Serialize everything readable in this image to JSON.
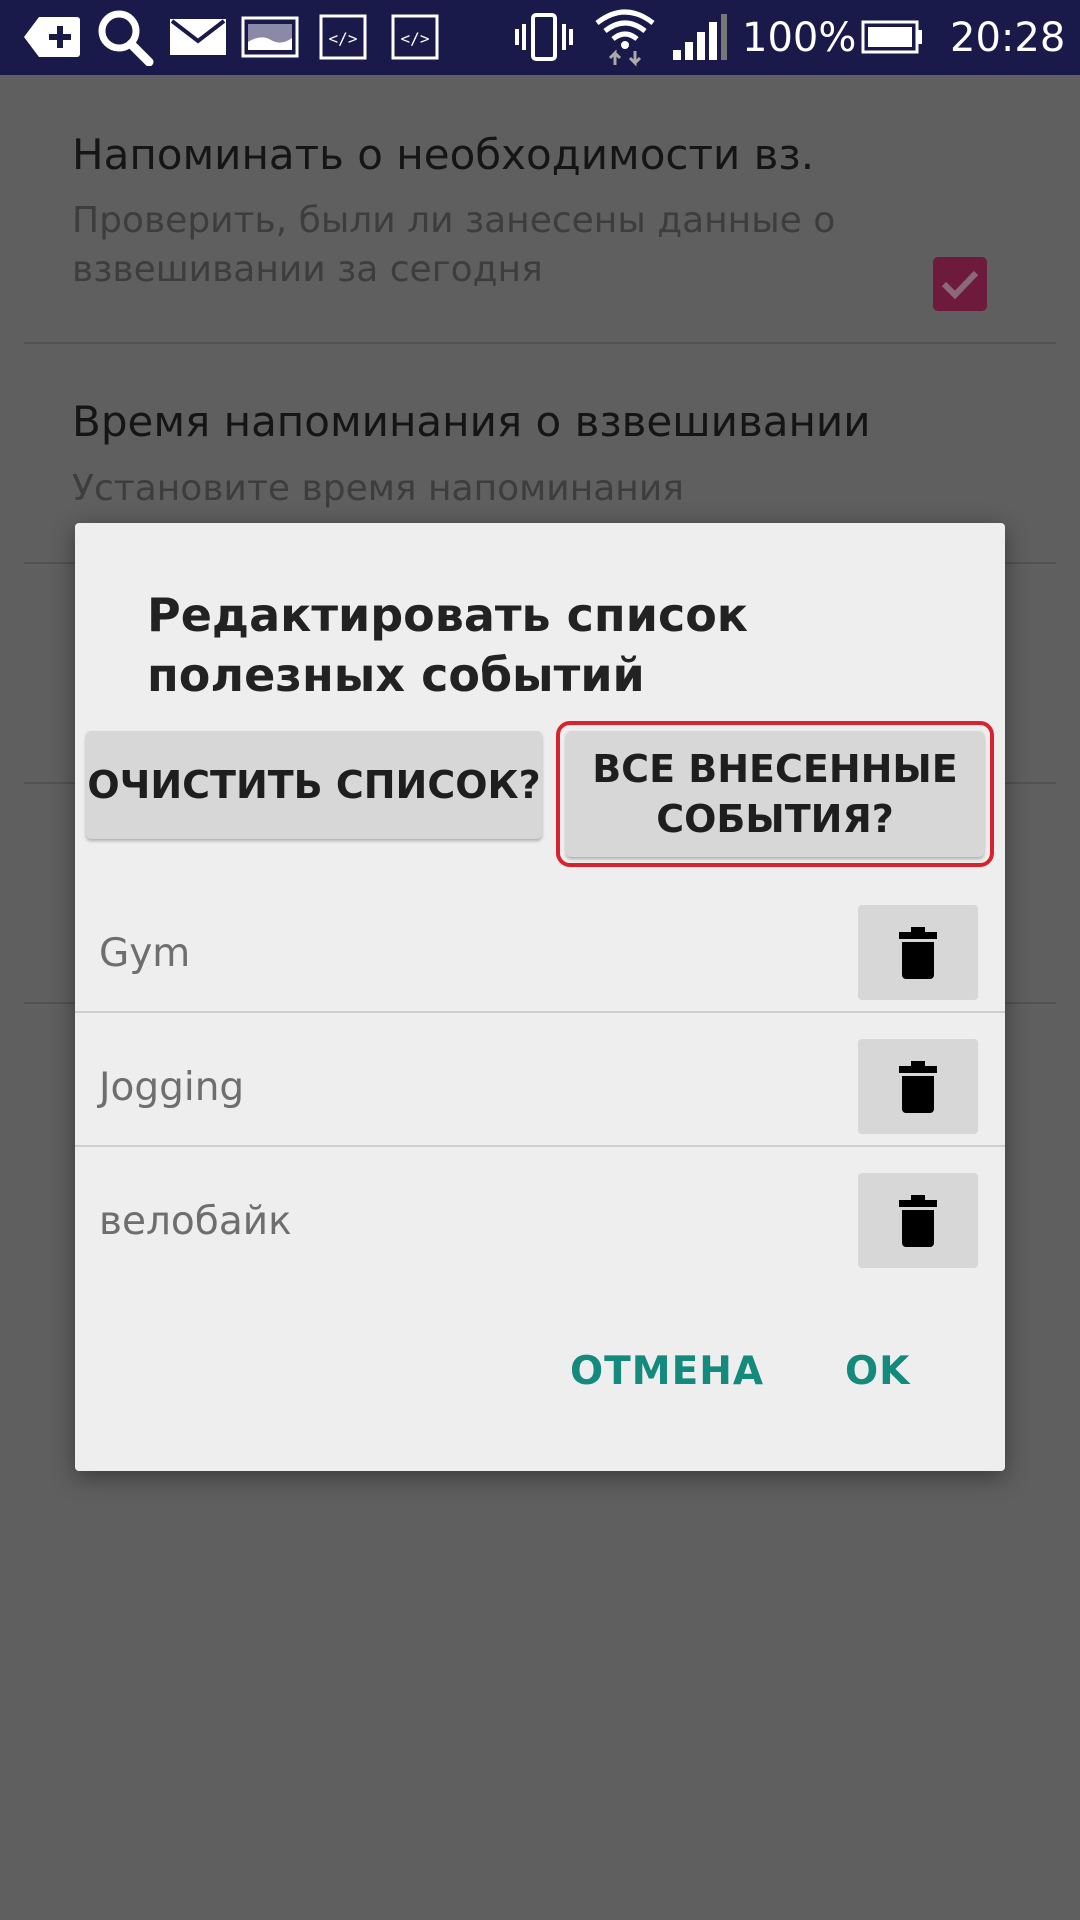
{
  "status_bar": {
    "battery_text": "100%",
    "time": "20:28",
    "icons": [
      "add-message-icon",
      "search-icon",
      "mail-icon",
      "image-icon",
      "code-icon",
      "code-icon",
      "vibrate-icon",
      "wifi-icon",
      "signal-icon",
      "battery-icon"
    ]
  },
  "settings": [
    {
      "title": "Напоминать о необходимости вз.",
      "summary": "Проверить, были ли занесены данные о взвешивании за сегодня",
      "checked": true
    },
    {
      "title": "Время напоминания о взвешивании",
      "summary": "Установите время напоминания"
    }
  ],
  "dialog": {
    "title": "Редактировать список полезных событий",
    "clear_button": "ОЧИСТИТЬ СПИСОК?",
    "all_events_button": "ВСЕ ВНЕСЕННЫЕ СОБЫТИЯ?",
    "events": [
      {
        "label": "Gym"
      },
      {
        "label": "Jogging"
      },
      {
        "label": "велобайк"
      }
    ],
    "cancel_button": "ОТМЕНА",
    "ok_button": "OK"
  },
  "colors": {
    "status_bar": "#1a1a4a",
    "accent": "#138a7c",
    "highlight": "#d8232f",
    "checkbox": "#6e1a3c"
  }
}
